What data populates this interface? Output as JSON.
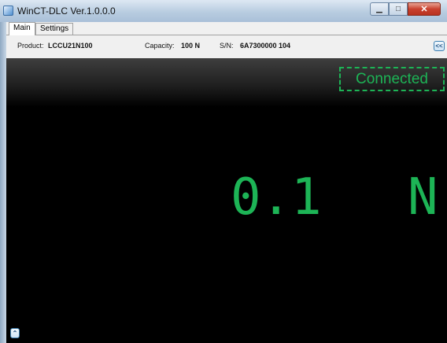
{
  "window": {
    "title": "WinCT-DLC Ver.1.0.0.0",
    "min_icon": "▁",
    "max_icon": "□",
    "close_icon": "✕"
  },
  "tabs": [
    {
      "label": "Main",
      "active": true
    },
    {
      "label": "Settings",
      "active": false
    }
  ],
  "info": {
    "product_label": "Product:",
    "product_value": "LCCU21N100",
    "capacity_label": "Capacity:",
    "capacity_value": "100 N",
    "sn_label": "S/N:",
    "sn_value": "6A7300000 104",
    "collapse_button": "<<"
  },
  "display": {
    "status": "Connected",
    "reading": "0.1",
    "unit": "N",
    "expand_button": "⌃"
  },
  "colors": {
    "accent": "#1db456",
    "background": "#000000"
  }
}
